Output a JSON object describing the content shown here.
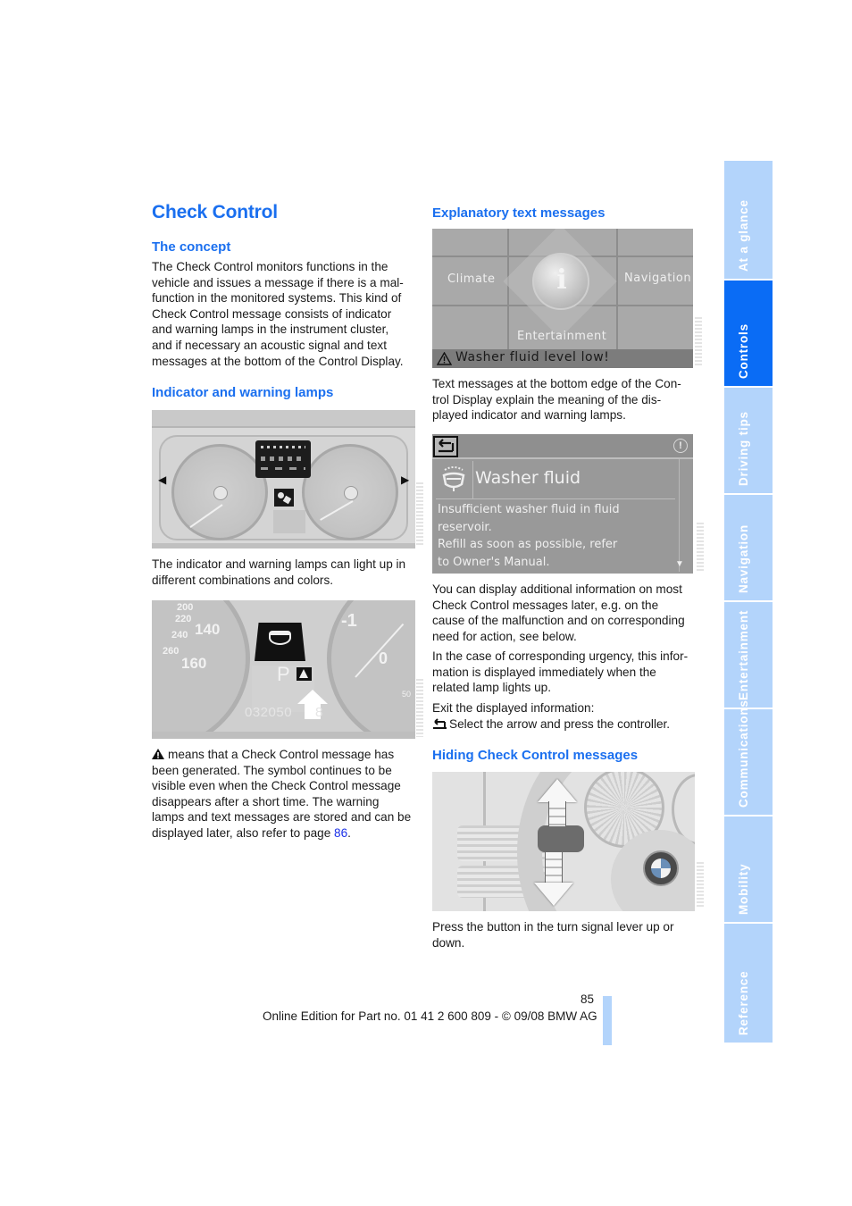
{
  "page": {
    "title": "Check Control",
    "page_number": "85",
    "footer": "Online Edition for Part no. 01 41 2 600 809 - © 09/08 BMW AG"
  },
  "left_column": {
    "concept": {
      "heading": "The concept",
      "lines": [
        "The Check Control monitors functions in the",
        "vehicle and issues a message if there is a mal-",
        "function in the monitored systems. This kind of",
        "Check Control message consists of indicator",
        "and warning lamps in the instrument cluster,",
        "and if necessary an acoustic signal and text",
        "messages at the bottom of the Control Display."
      ]
    },
    "lamps": {
      "heading": "Indicator and warning lamps",
      "caption_lines": [
        "The indicator and warning lamps can light up in",
        "different combinations and colors."
      ],
      "figure2": {
        "speed_labels": [
          "200",
          "220",
          "140",
          "240",
          "260",
          "160"
        ],
        "gear": "P",
        "odometer": "032050",
        "odometer_tail": "8",
        "rpm_label": "-1",
        "rpm_label_2": "0",
        "rpm_small": "50"
      },
      "note_first": "means that a Check Control message has",
      "note_lines": [
        "been generated. The symbol continues to be",
        "visible even when the Check Control message",
        "disappears after a short time. The warning",
        "lamps and text messages are stored and can be"
      ],
      "note_last_prefix": "displayed later, also refer to page ",
      "note_link": "86",
      "note_last_suffix": "."
    }
  },
  "right_column": {
    "explanatory": {
      "heading": "Explanatory text messages",
      "display": {
        "menu_left": "Climate",
        "menu_right": "Navigation",
        "menu_bottom": "Entertainment",
        "status_message": "Washer fluid level low!"
      },
      "caption_lines": [
        "Text messages at the bottom edge of the Con-",
        "trol Display explain the meaning of the dis-",
        "played indicator and warning lamps."
      ]
    },
    "info_display": {
      "title": "Washer fluid",
      "body_lines": [
        "Insufficient washer fluid in fluid",
        "reservoir.",
        "Refill as soon as possible, refer",
        "to Owner's Manual."
      ]
    },
    "additional": {
      "para1": [
        "You can display additional information on most",
        "Check Control messages later, e.g. on the",
        "cause of the malfunction and on corresponding",
        "need for action, see below."
      ],
      "para2": [
        "In the case of corresponding urgency, this infor-",
        "mation is displayed immediately when the",
        "related lamp lights up."
      ],
      "exit_label": "Exit the displayed information:",
      "exit_step": "Select the arrow and press the controller."
    },
    "hiding": {
      "heading": "Hiding Check Control messages",
      "caption_lines": [
        "Press the button in the turn signal lever up or",
        "down."
      ]
    }
  },
  "sidebar": {
    "tabs": [
      {
        "label": "At a glance",
        "active": false
      },
      {
        "label": "Controls",
        "active": true
      },
      {
        "label": "Driving tips",
        "active": false
      },
      {
        "label": "Navigation",
        "active": false
      },
      {
        "label": "Entertainment",
        "active": false
      },
      {
        "label": "Communications",
        "active": false
      },
      {
        "label": "Mobility",
        "active": false
      },
      {
        "label": "Reference",
        "active": false
      }
    ]
  },
  "colors": {
    "heading_blue": "#1a6fef",
    "tab_active": "#0a6cf5",
    "tab_inactive": "#b3d4fb",
    "link": "#1a2fe8"
  }
}
